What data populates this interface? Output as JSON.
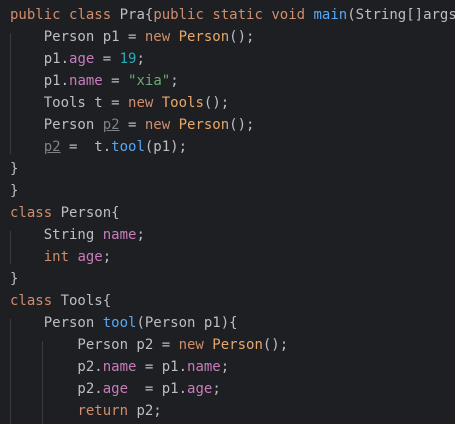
{
  "editor": {
    "lines": [
      [
        {
          "t": "public ",
          "c": "kw"
        },
        {
          "t": "class ",
          "c": "kw"
        },
        {
          "t": "Pra{",
          "c": "txt"
        },
        {
          "t": "public ",
          "c": "kw"
        },
        {
          "t": "static ",
          "c": "kw"
        },
        {
          "t": "void ",
          "c": "kw"
        },
        {
          "t": "main",
          "c": "fn"
        },
        {
          "t": "(String[]args){",
          "c": "txt"
        }
      ],
      [
        {
          "t": "    Person p1 = ",
          "c": "txt"
        },
        {
          "t": "new ",
          "c": "kw"
        },
        {
          "t": "Person",
          "c": "ctor"
        },
        {
          "t": "();",
          "c": "txt"
        }
      ],
      [
        {
          "t": "    p1.",
          "c": "txt"
        },
        {
          "t": "age",
          "c": "fld"
        },
        {
          "t": " = ",
          "c": "txt"
        },
        {
          "t": "19",
          "c": "num"
        },
        {
          "t": ";",
          "c": "txt"
        }
      ],
      [
        {
          "t": "    p1.",
          "c": "txt"
        },
        {
          "t": "name",
          "c": "fld"
        },
        {
          "t": " = ",
          "c": "txt"
        },
        {
          "t": "\"xia\"",
          "c": "str"
        },
        {
          "t": ";",
          "c": "txt"
        }
      ],
      [
        {
          "t": "    Tools t = ",
          "c": "txt"
        },
        {
          "t": "new ",
          "c": "kw"
        },
        {
          "t": "Tools",
          "c": "ctor"
        },
        {
          "t": "();",
          "c": "txt"
        }
      ],
      [
        {
          "t": "    Person ",
          "c": "txt"
        },
        {
          "t": "p2",
          "c": "unused"
        },
        {
          "t": " = ",
          "c": "txt"
        },
        {
          "t": "new ",
          "c": "kw"
        },
        {
          "t": "Person",
          "c": "ctor"
        },
        {
          "t": "();",
          "c": "txt"
        }
      ],
      [
        {
          "t": "    ",
          "c": "txt"
        },
        {
          "t": "p2",
          "c": "unused"
        },
        {
          "t": " =  t.",
          "c": "txt"
        },
        {
          "t": "tool",
          "c": "call"
        },
        {
          "t": "(p1);",
          "c": "txt"
        }
      ],
      [
        {
          "t": "}",
          "c": "txt"
        }
      ],
      [
        {
          "t": "}",
          "c": "txt"
        }
      ],
      [
        {
          "t": "class ",
          "c": "kw"
        },
        {
          "t": "Person{",
          "c": "txt"
        }
      ],
      [
        {
          "t": "    String ",
          "c": "txt"
        },
        {
          "t": "name",
          "c": "fld"
        },
        {
          "t": ";",
          "c": "txt"
        }
      ],
      [
        {
          "t": "    ",
          "c": "txt"
        },
        {
          "t": "int ",
          "c": "kw"
        },
        {
          "t": "age",
          "c": "fld"
        },
        {
          "t": ";",
          "c": "txt"
        }
      ],
      [
        {
          "t": "}",
          "c": "txt"
        }
      ],
      [
        {
          "t": "class ",
          "c": "kw"
        },
        {
          "t": "Tools{",
          "c": "txt"
        }
      ],
      [
        {
          "t": "    Person ",
          "c": "txt"
        },
        {
          "t": "tool",
          "c": "fn"
        },
        {
          "t": "(Person p1){",
          "c": "txt"
        }
      ],
      [
        {
          "t": "        Person p2 = ",
          "c": "txt"
        },
        {
          "t": "new ",
          "c": "kw"
        },
        {
          "t": "Person",
          "c": "ctor"
        },
        {
          "t": "();",
          "c": "txt"
        }
      ],
      [
        {
          "t": "        p2.",
          "c": "txt"
        },
        {
          "t": "name",
          "c": "fld"
        },
        {
          "t": " = p1.",
          "c": "txt"
        },
        {
          "t": "name",
          "c": "fld"
        },
        {
          "t": ";",
          "c": "txt"
        }
      ],
      [
        {
          "t": "        p2.",
          "c": "txt"
        },
        {
          "t": "age",
          "c": "fld"
        },
        {
          "t": "  = p1.",
          "c": "txt"
        },
        {
          "t": "age",
          "c": "fld"
        },
        {
          "t": ";",
          "c": "txt"
        }
      ],
      [
        {
          "t": "        ",
          "c": "txt"
        },
        {
          "t": "return ",
          "c": "kw"
        },
        {
          "t": "p2;",
          "c": "txt"
        }
      ]
    ]
  },
  "colors": {
    "background": "#1e1f22",
    "keyword": "#cf8e6d",
    "method": "#56a8f5",
    "field": "#c77dbb",
    "number": "#2aacb8",
    "string": "#6aab73",
    "text": "#bcbec4"
  }
}
